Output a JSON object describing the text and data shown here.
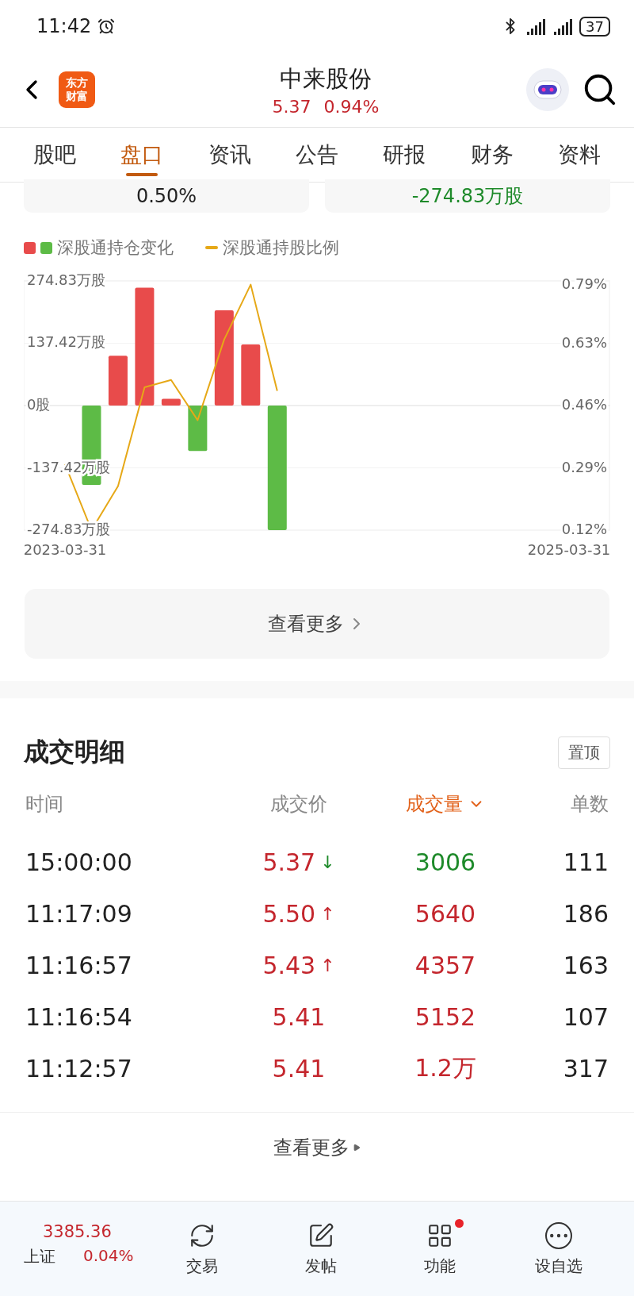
{
  "status_bar": {
    "time": "11:42",
    "battery": "37"
  },
  "header": {
    "logo": [
      "东方",
      "财富"
    ],
    "title": "中来股份",
    "price": "5.37",
    "change": "0.94%"
  },
  "tabs": [
    {
      "label": "股吧",
      "selected": false
    },
    {
      "label": "盘口",
      "selected": true
    },
    {
      "label": "资讯",
      "selected": false
    },
    {
      "label": "公告",
      "selected": false
    },
    {
      "label": "研报",
      "selected": false
    },
    {
      "label": "财务",
      "selected": false
    },
    {
      "label": "资料",
      "selected": false
    }
  ],
  "summary_cards": [
    {
      "value": "0.50%",
      "color": "#222222"
    },
    {
      "value": "-274.83万股",
      "color": "#1e8a2a"
    }
  ],
  "chart": {
    "chart_data": {
      "type": "bar",
      "stacked": true,
      "categories": [
        "2023-03-31",
        null,
        null,
        null,
        null,
        null,
        null,
        null,
        null,
        null,
        null,
        null,
        null,
        null,
        null,
        null,
        null,
        null,
        null,
        "2025-03-31"
      ],
      "ylim": [
        -274.83,
        274.83
      ],
      "yticks": [
        {
          "value": 274.83,
          "label": "274.83万股"
        },
        {
          "value": 137.42,
          "label": "137.42万股"
        },
        {
          "value": 0,
          "label": "0股"
        },
        {
          "value": -137.42,
          "label": "-137.42万股"
        },
        {
          "value": -274.83,
          "label": "-274.83万股"
        }
      ],
      "y2lim": [
        0.12,
        0.8
      ],
      "y2ticks": [
        {
          "value": 0.79,
          "label": "0.79%"
        },
        {
          "value": 0.63,
          "label": "0.63%"
        },
        {
          "value": 0.46,
          "label": "0.46%"
        },
        {
          "value": 0.29,
          "label": "0.29%"
        },
        {
          "value": 0.12,
          "label": "0.12%"
        }
      ],
      "series": [
        {
          "name": "深股通持仓变化",
          "color": "#e84b4b",
          "values": [
            null,
            null,
            110,
            260,
            15,
            null,
            210,
            135,
            null,
            null,
            null,
            null,
            null,
            null,
            null,
            null,
            null,
            null,
            null,
            null
          ]
        },
        {
          "color": "#5dbb46",
          "values": [
            null,
            -175,
            null,
            null,
            null,
            -100,
            null,
            null,
            -274.83,
            null,
            null,
            null,
            null,
            null,
            null,
            null,
            null,
            null,
            null,
            null
          ]
        },
        {
          "name": "深股通持股比例",
          "type": "line",
          "axis": "y2",
          "color": "#e6a817",
          "values": [
            0.3,
            0.12,
            0.24,
            0.51,
            0.53,
            0.42,
            0.64,
            0.79,
            0.5,
            null,
            null,
            null,
            null,
            null,
            null,
            null,
            null,
            null,
            null,
            null
          ]
        }
      ]
    }
  },
  "more_button": "查看更多",
  "trades": {
    "title": "成交明细",
    "pin_button": "置顶",
    "columns": [
      {
        "label": "时间",
        "selected": false
      },
      {
        "label": "成交价",
        "selected": false
      },
      {
        "label": "成交量",
        "selected": true
      },
      {
        "label": "单数",
        "selected": false
      }
    ],
    "rows": [
      {
        "time": "15:00:00",
        "price": "5.37",
        "arrow": {
          "symbol": "↓",
          "color": "#1e8a2a"
        },
        "volume": "3006",
        "color": "#1e8a2a",
        "count": "111"
      },
      {
        "time": "11:17:09",
        "price": "5.50",
        "arrow": {
          "symbol": "↑",
          "color": "#c4262d"
        },
        "volume": "5640",
        "color": "#c4262d",
        "count": "186"
      },
      {
        "time": "11:16:57",
        "price": "5.43",
        "arrow": {
          "symbol": "↑",
          "color": "#c4262d"
        },
        "volume": "4357",
        "color": "#c4262d",
        "count": "163"
      },
      {
        "time": "11:16:54",
        "price": "5.41",
        "volume": "5152",
        "color": "#c4262d",
        "count": "107"
      },
      {
        "time": "11:12:57",
        "price": "5.41",
        "volume": "1.2万",
        "color": "#c4262d",
        "count": "317"
      }
    ],
    "more": "查看更多"
  },
  "bottom_bar": {
    "index": {
      "value": "3385.36",
      "name": "上证",
      "change": "0.04%"
    },
    "items": [
      {
        "label": "交易",
        "kind": "trade",
        "badge": false
      },
      {
        "label": "发帖",
        "kind": "post",
        "badge": false
      },
      {
        "label": "功能",
        "kind": "apps",
        "badge": true
      },
      {
        "label": "设自选",
        "kind": "more",
        "badge": false
      }
    ]
  }
}
